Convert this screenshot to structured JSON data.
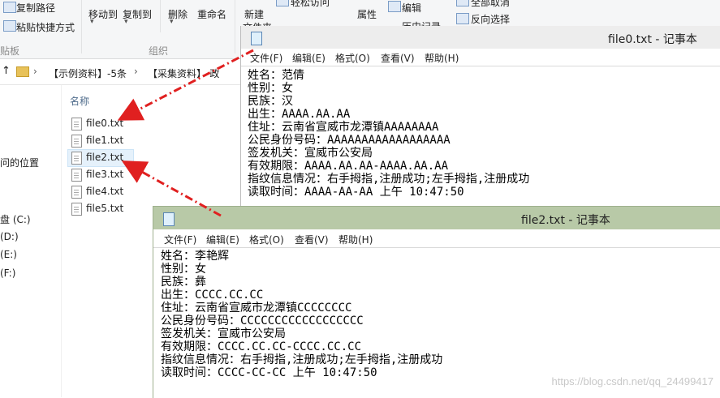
{
  "ribbon": {
    "copy_path": "复制路径",
    "paste_shortcut": "粘贴快捷方式",
    "move_to": "移动到",
    "copy_to": "复制到",
    "delete": "删除",
    "rename": "重命名",
    "new_folder": "新建",
    "new_folder2": "文件夹",
    "easy_access": "轻松访问",
    "properties": "属性",
    "edit": "编辑",
    "history": "历史记录",
    "select_none": "全部取消",
    "invert_selection": "反向选择",
    "group_clipboard": "贴板",
    "group_organize": "组织"
  },
  "address": {
    "up_arrow": "↑",
    "crumb1": "【示例资料】-5条",
    "sep": "›",
    "crumb2": "【采集资料】-政"
  },
  "nav": {
    "items": [
      "问的位置",
      "盘 (C:)",
      "(D:)",
      "(E:)",
      "(F:)"
    ]
  },
  "files": {
    "header": "名称",
    "items": [
      "file0.txt",
      "file1.txt",
      "file2.txt",
      "file3.txt",
      "file4.txt",
      "file5.txt"
    ]
  },
  "notepad0": {
    "title": "file0.txt - 记事本",
    "menu": [
      "文件(F)",
      "编辑(E)",
      "格式(O)",
      "查看(V)",
      "帮助(H)"
    ],
    "lines": [
      "姓名：范倩",
      "性别：女",
      "民族：汉",
      "出生：AAAA.AA.AA",
      "住址：云南省宣威市龙潭镇AAAAAAAA",
      "公民身份号码：AAAAAAAAAAAAAAAAAA",
      "签发机关：宣威市公安局",
      "有效期限：AAAA.AA.AA-AAAA.AA.AA",
      "指纹信息情况：右手拇指,注册成功;左手拇指,注册成功",
      "读取时间：AAAA-AA-AA 上午 10:47:50"
    ]
  },
  "notepad2": {
    "title": "file2.txt - 记事本",
    "menu": [
      "文件(F)",
      "编辑(E)",
      "格式(O)",
      "查看(V)",
      "帮助(H)"
    ],
    "lines": [
      "姓名：李艳辉",
      "性别：女",
      "民族：彝",
      "出生：CCCC.CC.CC",
      "住址：云南省宣威市龙潭镇CCCCCCCC",
      "公民身份号码：CCCCCCCCCCCCCCCCCC",
      "签发机关：宣威市公安局",
      "有效期限：CCCC.CC.CC-CCCC.CC.CC",
      "指纹信息情况：右手拇指,注册成功;左手拇指,注册成功",
      "读取时间：CCCC-CC-CC 上午 10:47:50"
    ]
  },
  "watermark": "https://blog.csdn.net/qq_24499417",
  "colors": {
    "titlebar": "#ededed",
    "titlebar_active": "#b8c9a7",
    "arrow": "#e02020",
    "selection": "#e5f1fb"
  }
}
